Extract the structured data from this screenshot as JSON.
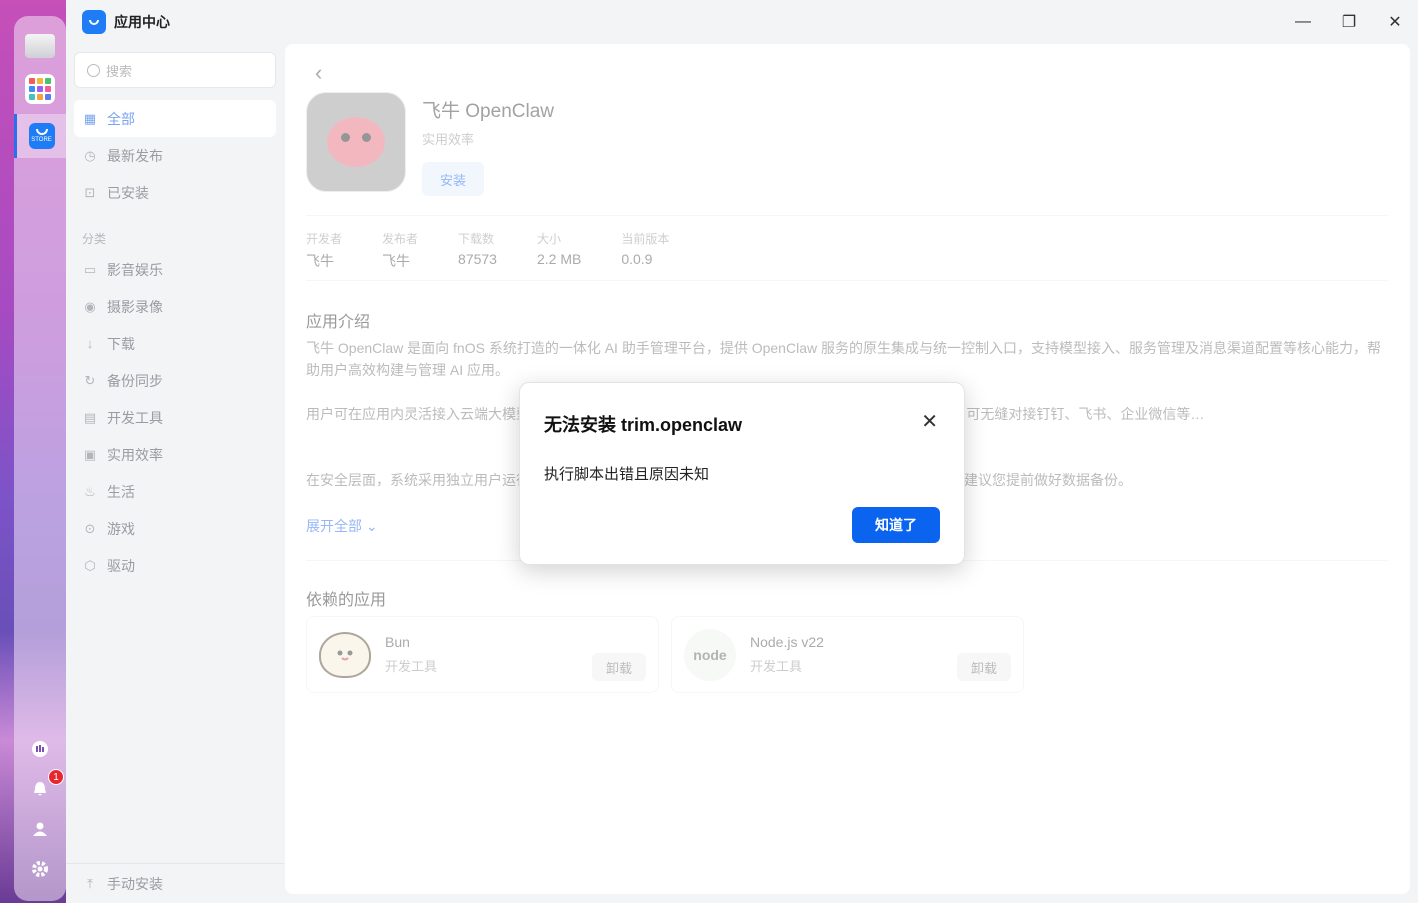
{
  "window": {
    "title": "应用中心"
  },
  "sidebar": {
    "search_placeholder": "搜索",
    "nav": [
      {
        "label": "全部",
        "icon": "grid-icon",
        "active": true
      },
      {
        "label": "最新发布",
        "icon": "clock-icon"
      },
      {
        "label": "已安装",
        "icon": "installed-icon"
      }
    ],
    "category_label": "分类",
    "categories": [
      {
        "label": "影音娱乐",
        "icon": "video-icon"
      },
      {
        "label": "摄影录像",
        "icon": "camera-icon"
      },
      {
        "label": "下载",
        "icon": "download-icon"
      },
      {
        "label": "备份同步",
        "icon": "sync-icon"
      },
      {
        "label": "开发工具",
        "icon": "code-icon"
      },
      {
        "label": "实用效率",
        "icon": "briefcase-icon"
      },
      {
        "label": "生活",
        "icon": "life-icon"
      },
      {
        "label": "游戏",
        "icon": "gamepad-icon"
      },
      {
        "label": "驱动",
        "icon": "cube-icon"
      }
    ],
    "manual_install": "手动安装"
  },
  "app": {
    "name": "飞牛 OpenClaw",
    "category": "实用效率",
    "install_label": "安装",
    "meta": [
      {
        "key": "开发者",
        "value": "飞牛"
      },
      {
        "key": "发布者",
        "value": "飞牛"
      },
      {
        "key": "下载数",
        "value": "87573"
      },
      {
        "key": "大小",
        "value": "2.2 MB"
      },
      {
        "key": "当前版本",
        "value": "0.0.9"
      }
    ],
    "intro_title": "应用介绍",
    "description": [
      "飞牛 OpenClaw 是面向 fnOS 系统打造的一体化 AI 助手管理平台，提供 OpenClaw 服务的原生集成与统一控制入口，支持模型接入、服务管理及消息渠道配置等核心能力，帮助用户高效构建与管理 AI 应用。",
      "用户可在应用内灵活接入云端大模型…任务执行能力，实现自动化处理与智能化工作流，同时通过官方 API 可无缝对接钉钉、飞书、企业微信等…",
      "在安全层面，系统采用独立用户运行…并预设提示词防护，但依然存在权限范围内的文件修改或删除行为，建议您提前做好数据备份。"
    ],
    "expand_label": "展开全部",
    "deps_title": "依赖的应用",
    "deps": [
      {
        "name": "Bun",
        "category": "开发工具",
        "action": "卸载"
      },
      {
        "name": "Node.js v22",
        "category": "开发工具",
        "action": "卸载",
        "logo_text": "node"
      }
    ]
  },
  "dialog": {
    "title": "无法安装 trim.openclaw",
    "message": "执行脚本出错且原因未知",
    "ok_label": "知道了"
  },
  "dock": {
    "notification_count": "1"
  }
}
